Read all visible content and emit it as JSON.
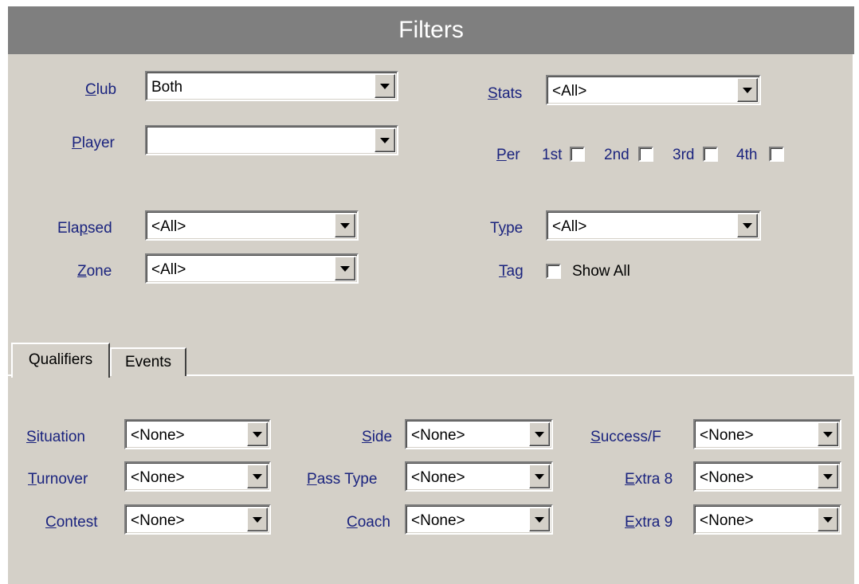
{
  "title": "Filters",
  "filters": {
    "club": {
      "label_ul": "C",
      "label_rest": "lub",
      "value": "Both"
    },
    "player": {
      "label_ul": "P",
      "label_rest": "layer",
      "value": ""
    },
    "elapsed": {
      "label_pre": "Ela",
      "label_ul": "p",
      "label_rest": "sed",
      "value": "<All>"
    },
    "zone": {
      "label_ul": "Z",
      "label_rest": "one",
      "value": "<All>"
    },
    "stats": {
      "label_ul": "S",
      "label_rest": "tats",
      "value": "<All>"
    },
    "per": {
      "label_ul": "P",
      "label_rest": "er",
      "periods": [
        {
          "label": "1st",
          "checked": false
        },
        {
          "label": "2nd",
          "checked": false
        },
        {
          "label": "3rd",
          "checked": false
        },
        {
          "label": "4th",
          "checked": false
        }
      ]
    },
    "type": {
      "label_pre": "T",
      "label_ul": "y",
      "label_rest": "pe",
      "value": "<All>"
    },
    "tag": {
      "label_ul": "T",
      "label_rest": "ag",
      "show_all_label": "Show All",
      "checked": false
    }
  },
  "tabs": [
    {
      "label": "Qualifiers",
      "active": true
    },
    {
      "label": "Events",
      "active": false
    }
  ],
  "qualifiers": {
    "situation": {
      "label_ul": "S",
      "label_rest": "ituation",
      "value": "<None>"
    },
    "turnover": {
      "label_ul": "T",
      "label_rest": "urnover",
      "value": "<None>"
    },
    "contest": {
      "label_ul": "C",
      "label_rest": "ontest",
      "value": "<None>"
    },
    "side": {
      "label_ul": "S",
      "label_rest": "ide",
      "value": "<None>"
    },
    "pass_type": {
      "label_ul": "P",
      "label_rest": "ass Type",
      "value": "<None>"
    },
    "coach": {
      "label_ul": "C",
      "label_rest": "oach",
      "value": "<None>"
    },
    "success": {
      "label_ul": "S",
      "label_rest": "uccess/F",
      "value": "<None>"
    },
    "extra8": {
      "label_ul": "E",
      "label_rest": "xtra 8",
      "value": "<None>"
    },
    "extra9": {
      "label_ul": "E",
      "label_rest": "xtra 9",
      "value": "<None>"
    }
  }
}
